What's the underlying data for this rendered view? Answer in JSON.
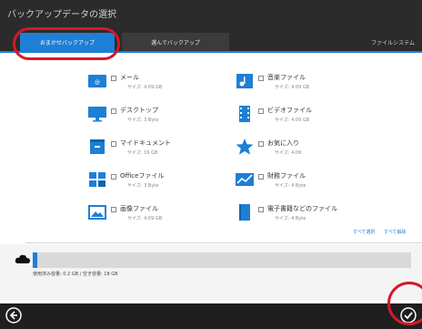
{
  "header": {
    "title": "バックアップデータの選択",
    "tabs": [
      {
        "label": "おまかせバックアップ",
        "selected": true
      },
      {
        "label": "選んでバックアップ",
        "selected": false
      }
    ],
    "right_label": "ファイルシステム"
  },
  "items": [
    {
      "name": "メール",
      "size": "サイズ: 4.09 GB",
      "icon": "mail-icon",
      "checked": true
    },
    {
      "name": "音楽ファイル",
      "size": "サイズ: 4.09 GB",
      "icon": "music-icon",
      "checked": true
    },
    {
      "name": "デスクトップ",
      "size": "サイズ: 3 Byte",
      "icon": "desktop-icon",
      "checked": true
    },
    {
      "name": "ビデオファイル",
      "size": "サイズ: 4.09 GB",
      "icon": "video-icon",
      "checked": true
    },
    {
      "name": "マイドキュメント",
      "size": "サイズ: 16 GB",
      "icon": "documents-icon",
      "checked": true
    },
    {
      "name": "お気に入り",
      "size": "サイズ: 4.09",
      "icon": "star-icon",
      "checked": true
    },
    {
      "name": "Officeファイル",
      "size": "サイズ: 3 Byte",
      "icon": "office-icon",
      "checked": true
    },
    {
      "name": "財務ファイル",
      "size": "サイズ: 4 Byte",
      "icon": "finance-icon",
      "checked": true
    },
    {
      "name": "画像ファイル",
      "size": "サイズ: 4.09 GB",
      "icon": "picture-icon",
      "checked": true
    },
    {
      "name": "電子書籍などのファイル",
      "size": "サイズ: 4 Byte",
      "icon": "ebook-icon",
      "checked": true
    }
  ],
  "links": {
    "select_all": "すべて選択",
    "clear_all": "すべて解除"
  },
  "storage": {
    "text": "使用済み容量: 0.2 GB / 空き容量: 18 GB",
    "progress": 0.012
  },
  "footer": {
    "back": "back-arrow-icon",
    "ok": "check-icon"
  },
  "colors": {
    "accent": "#1e7fd6",
    "header": "#2b2b2b",
    "footer": "#1f1f1f",
    "highlight": "#d6182a"
  }
}
